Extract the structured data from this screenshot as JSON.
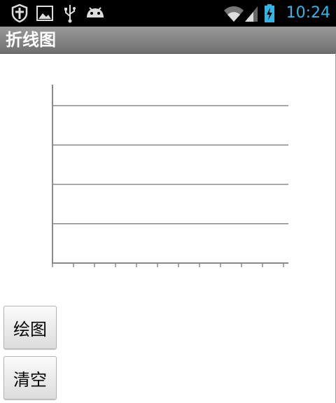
{
  "status_bar": {
    "time": "10:24",
    "time_color": "#33b5e5",
    "icons": [
      "shield-icon",
      "image-icon",
      "usb-icon",
      "android-icon",
      "wifi-icon",
      "signal-icon",
      "battery-charging-icon"
    ]
  },
  "app": {
    "title": "折线图"
  },
  "chart_data": {
    "type": "line",
    "title": "",
    "xlabel": "",
    "ylabel": "",
    "series": [],
    "grid": true,
    "y_gridlines": 5,
    "x_ticks": 12
  },
  "buttons": {
    "draw_label": "绘图",
    "clear_label": "清空"
  }
}
